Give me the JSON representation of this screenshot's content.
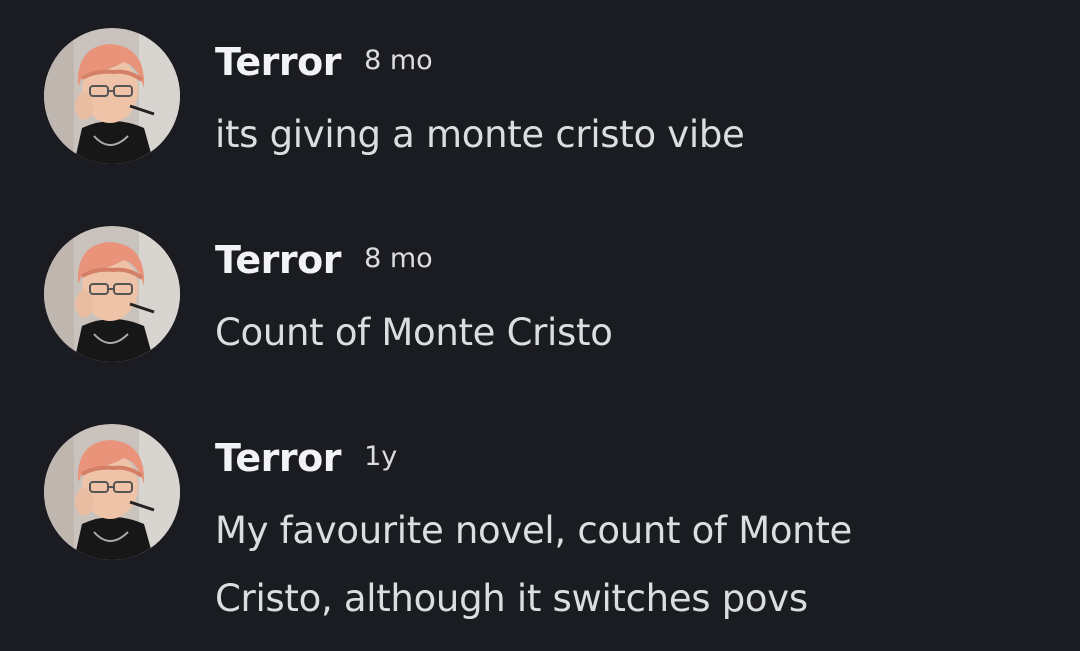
{
  "messages": [
    {
      "author": "Terror",
      "timestamp": "8 mo",
      "text": "its giving a monte cristo vibe",
      "avatar": "user-avatar"
    },
    {
      "author": "Terror",
      "timestamp": "8 mo",
      "text": "Count of Monte Cristo",
      "avatar": "user-avatar"
    },
    {
      "author": "Terror",
      "timestamp": "1y",
      "text": "My favourite novel, count of Monte Cristo, although it switches povs",
      "avatar": "user-avatar"
    }
  ],
  "colors": {
    "background": "#1b1c21",
    "username": "#f2f3f5",
    "text": "#dbdee1",
    "hair": "#e8937a"
  }
}
